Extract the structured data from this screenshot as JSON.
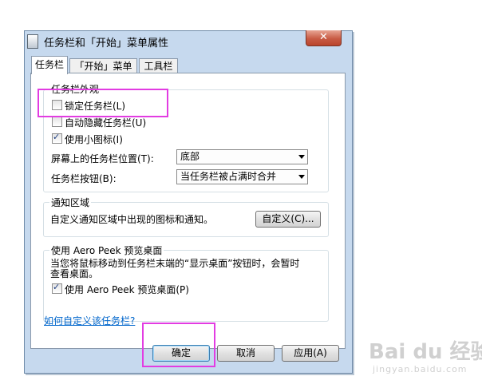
{
  "window": {
    "title": "任务栏和「开始」菜单属性",
    "close_glyph": "✕"
  },
  "tabs": [
    {
      "label": "任务栏"
    },
    {
      "label": "「开始」菜单"
    },
    {
      "label": "工具栏"
    }
  ],
  "appearance": {
    "title": "任务栏外观",
    "lock_taskbar": {
      "label": "锁定任务栏(L)",
      "checked": false
    },
    "auto_hide": {
      "label": "自动隐藏任务栏(U)",
      "checked": false
    },
    "small_icons": {
      "label": "使用小图标(I)",
      "checked": true
    },
    "location_label": "屏幕上的任务栏位置(T):",
    "location_value": "底部",
    "buttons_label": "任务栏按钮(B):",
    "buttons_value": "当任务栏被占满时合并"
  },
  "notification": {
    "title": "通知区域",
    "text": "自定义通知区域中出现的图标和通知。",
    "customize_button": "自定义(C)..."
  },
  "aero_peek": {
    "title": "使用 Aero Peek 预览桌面",
    "desc_line1": "当您将鼠标移动到任务栏末端的“显示桌面”按钮时，会暂时",
    "desc_line2": "查看桌面。",
    "checkbox": {
      "label": "使用 Aero Peek 预览桌面(P)",
      "checked": true
    }
  },
  "help_link": "如何自定义该任务栏?",
  "footer": {
    "ok": "确定",
    "cancel": "取消",
    "apply": "应用(A)"
  },
  "watermark": {
    "text": "Bai du 经验",
    "sub": "jingyan.baidu.com"
  },
  "colors": {
    "highlight": "#e23ce2",
    "link": "#0066cc"
  }
}
